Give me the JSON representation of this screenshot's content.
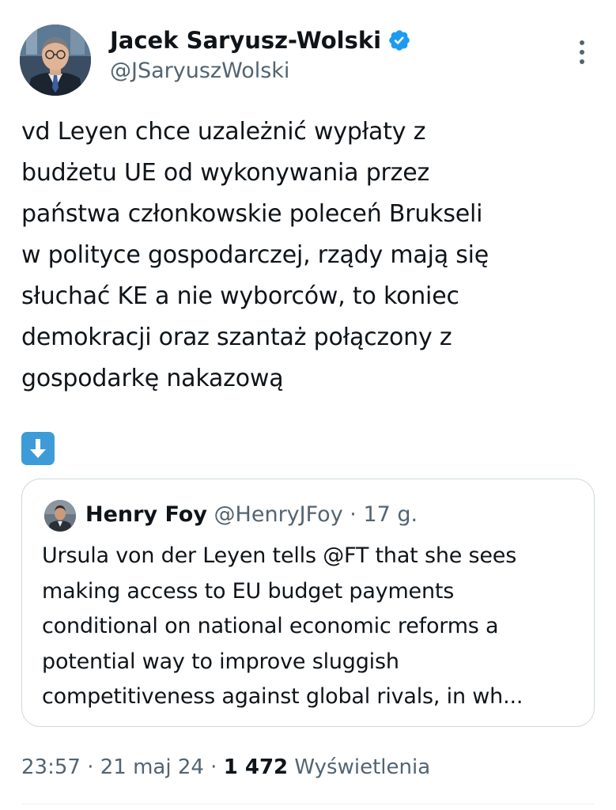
{
  "author": {
    "name": "Jacek Saryusz-Wolski",
    "handle": "@JSaryuszWolski",
    "verified": true
  },
  "tweet": {
    "text": "vd Leyen chce uzależnić wypłaty z\nbudżetu UE od wykonywania przez\npaństwa członkowskie poleceń Brukseli\nw polityce gospodarczej, rządy mają się\nsłuchać KE a nie wyborców, to koniec\ndemokracji oraz szantaż połączony z\ngospodarkę nakazową",
    "emoji_icon": "down-arrow-emoji-icon"
  },
  "quote": {
    "author_name": "Henry Foy",
    "author_handle": "@HenryJFoy",
    "separator": " · ",
    "time_ago": "17 g.",
    "text": "Ursula von der Leyen tells @FT that she sees\nmaking access to EU budget payments\nconditional on national economic reforms a\npotential way to improve sluggish\ncompetitiveness against global rivals, in wh..."
  },
  "meta": {
    "time": "23:57",
    "separator": " · ",
    "date": "21 maj 24",
    "views_count": "1 472",
    "views_label": "Wyświetlenia"
  },
  "colors": {
    "verified_badge": "#1d9bf0",
    "secondary_text": "#536471",
    "primary_text": "#0f1419",
    "border": "#cfd9de",
    "emoji_blue": "#3d9bd8"
  }
}
